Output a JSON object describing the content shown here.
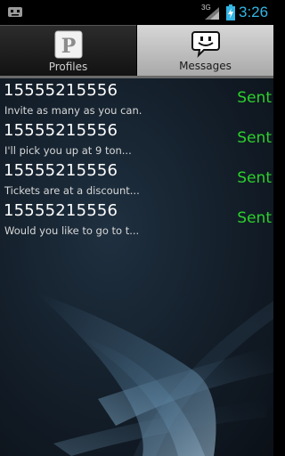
{
  "status_bar": {
    "network_label": "3G",
    "time": "3:26",
    "accent_color": "#33b5e5"
  },
  "tabs": [
    {
      "label": "Profiles",
      "icon": "profiles-p-icon",
      "selected": false
    },
    {
      "label": "Messages",
      "icon": "speech-bubble-smiley-icon",
      "selected": true
    }
  ],
  "messages": [
    {
      "number": "15555215556",
      "preview": "Invite as many as you can.",
      "status": "Sent"
    },
    {
      "number": "15555215556",
      "preview": "I'll pick you up at 9 ton...",
      "status": "Sent"
    },
    {
      "number": "15555215556",
      "preview": "Tickets are at a discount...",
      "status": "Sent"
    },
    {
      "number": "15555215556",
      "preview": "Would you like to go to t...",
      "status": "Sent"
    }
  ],
  "colors": {
    "status_sent": "#2cd02c",
    "tab_selected_bg": "#c2c2c2",
    "tab_unselected_bg": "#1e1e1e"
  }
}
